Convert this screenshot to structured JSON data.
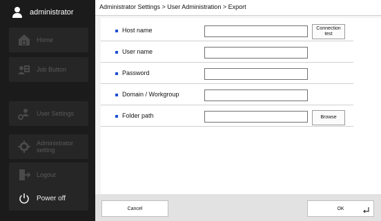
{
  "sidebar": {
    "user": "administrator",
    "items": [
      {
        "label": "Home",
        "icon": "home-icon"
      },
      {
        "label": "Job Button",
        "icon": "job-button-icon"
      },
      {
        "label": "User Settings",
        "icon": "user-settings-icon"
      },
      {
        "label": "Administrator setting",
        "icon": "admin-settings-icon"
      },
      {
        "label": "Logout",
        "icon": "logout-icon"
      }
    ],
    "power": "Power off"
  },
  "breadcrumb": "Administrator Settings > User Administration > Export",
  "form": {
    "host_name": {
      "label": "Host name",
      "value": ""
    },
    "user_name": {
      "label": "User name",
      "value": ""
    },
    "password": {
      "label": "Password",
      "value": ""
    },
    "domain": {
      "label": "Domain / Workgroup",
      "value": ""
    },
    "folder_path": {
      "label": "Folder path",
      "value": ""
    },
    "connection_test_label": "Connection test",
    "browse_label": "Browse"
  },
  "footer": {
    "cancel_label": "Cancel",
    "ok_label": "OK"
  },
  "colors": {
    "accent": "#1d4fd6",
    "sidebar_bg": "#1b1b1b"
  }
}
